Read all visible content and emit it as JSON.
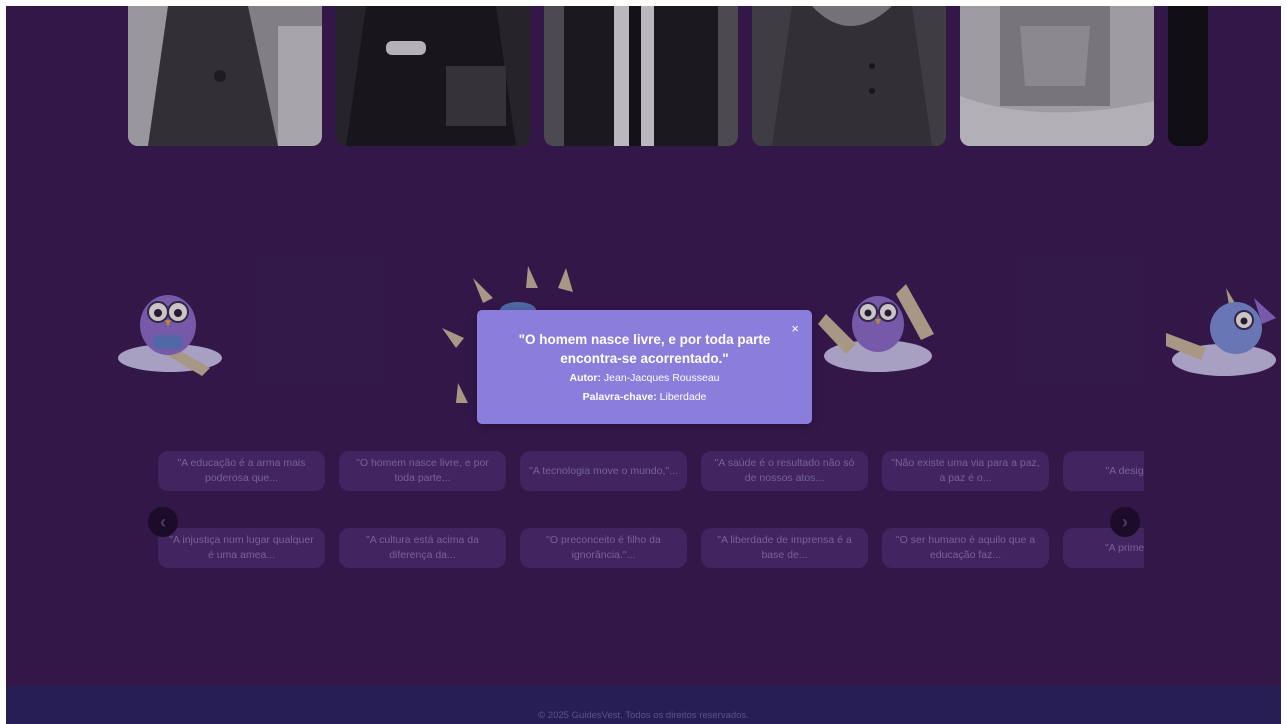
{
  "modal": {
    "quote": "\"O homem nasce livre, e por toda parte encontra-se acorrentado.\"",
    "author_label": "Autor:",
    "author": "Jean-Jacques Rousseau",
    "keyword_label": "Palavra-chave:",
    "keyword": "Liberdade",
    "close_label": "×"
  },
  "quote_cards": {
    "row1": [
      "\"A educação é a arma mais poderosa que...",
      "\"O homem nasce livre, e por toda parte...",
      "\"A tecnologia move o mundo,\"...",
      "\"A saúde é o resultado não só de nossos atos...",
      "\"Não existe uma via para a paz, a paz é o...",
      "\"A desigu maior d"
    ],
    "row2": [
      "\"A injustiça num lugar qualquer é uma amea...",
      "\"A cultura está acima da diferença da...",
      "\"O preconceito é filho da ignorância.\"...",
      "\"A liberdade de imprensa é a base de...",
      "\"O ser humano é aquilo que a educação faz...",
      "\"A prime importan"
    ]
  },
  "nav": {
    "prev_icon": "‹",
    "next_icon": "›"
  },
  "footer": {
    "text": "© 2025 GuidesVest. Todos os direitos reservados."
  },
  "colors": {
    "background": "#3a1b52",
    "modal": "#8b7ddc",
    "card": "#4b2b6e",
    "footer": "#2a2460"
  }
}
